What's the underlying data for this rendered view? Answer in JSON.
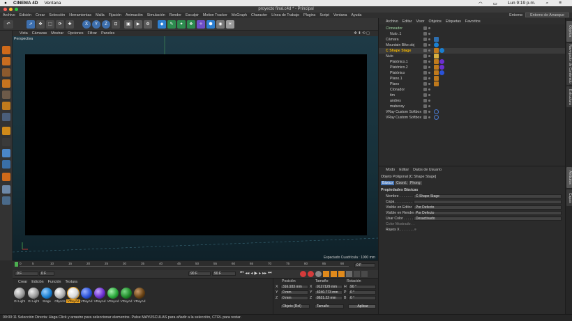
{
  "macbar": {
    "apple": "",
    "app": "CINEMA 4D",
    "menu": "Ventana",
    "clock": "Lun 9:19 p.m."
  },
  "window": {
    "title": "proyecto final.c4d * - Principal"
  },
  "menubar": [
    "Archivo",
    "Edición",
    "Crear",
    "Selección",
    "Herramientas",
    "Malla",
    "Fijación",
    "Animación",
    "Simulación",
    "Render",
    "Esculpir",
    "Motion Tracker",
    "MoGraph",
    "Character",
    "Línea de Trabajo",
    "Plugins",
    "Script",
    "Ventana",
    "Ayuda"
  ],
  "layout": {
    "label": "Entorno:",
    "value": "Entorno de Arranque"
  },
  "toolbar": {
    "x": "X",
    "y": "Y",
    "z": "Z"
  },
  "viewport": {
    "menu": [
      "Vista",
      "Cámaras",
      "Mostrar",
      "Opciones",
      "Filtrar",
      "Paneles"
    ],
    "label": "Perspectiva",
    "grid": "Espaciado Cuadrícula : 1000 mm"
  },
  "timeline": {
    "ticks": [
      "0",
      "5",
      "10",
      "15",
      "20",
      "25",
      "30",
      "35",
      "40",
      "45",
      "50",
      "55",
      "60",
      "65",
      "70",
      "75",
      "80",
      "85",
      "90"
    ],
    "end": "0 F",
    "start_field": "0 F",
    "min_field": "0 F",
    "max_field": "90 F",
    "max_field2": "90 F"
  },
  "materials": {
    "menu": [
      "Crear",
      "Edición",
      "Función",
      "Textura"
    ],
    "items": [
      "GI Light",
      "GI Light",
      "Stage",
      "Objects",
      "VRayAd",
      "VRayAd",
      "VRayAd",
      "VRayAd",
      "VRayAd",
      "VRayAd"
    ],
    "colors": [
      "#9a9a9a",
      "#9a9a9a",
      "#1a7fd1",
      "#b0b0b0",
      "#d8d8d8",
      "#2a52d9",
      "#6b2fd0",
      "#2aa93b",
      "#1f8a2a",
      "#6a4416"
    ]
  },
  "coords": {
    "h_pos": "Posición",
    "h_size": "Tamaño",
    "h_rot": "Rotación",
    "rows": [
      {
        "axis": "X",
        "pos": "316.933 mm",
        "size": "9127129 mm",
        "rlabel": "H",
        "rot": "90 °"
      },
      {
        "axis": "Y",
        "pos": "0 mm",
        "size": "4240.773 mm",
        "rlabel": "P",
        "rot": "0 °"
      },
      {
        "axis": "Z",
        "pos": "0 mm",
        "size": "8621.22 mm",
        "rlabel": "B",
        "rot": "0 °"
      }
    ],
    "mode1": "Objeto (Rel)",
    "mode2": "Tamaño",
    "apply": "Aplicar"
  },
  "objects": {
    "menu": [
      "Archivo",
      "Editar",
      "Visor",
      "Objetos",
      "Etiquetas",
      "Favoritos"
    ],
    "rows": [
      {
        "name": "Cloneador",
        "indent": 0,
        "color": "#9fd3a0"
      },
      {
        "name": "Nulo .1",
        "indent": 1,
        "color": "#ccc"
      },
      {
        "name": "Cámara",
        "indent": 0,
        "color": "#ccc"
      },
      {
        "name": "Mountain Bike.obj",
        "indent": 0,
        "color": "#ccc"
      },
      {
        "name": "C Shape Stage",
        "indent": 0,
        "color": "#f0b400"
      },
      {
        "name": "Nulo",
        "indent": 0,
        "color": "#ccc"
      },
      {
        "name": "Platónico.1",
        "indent": 1,
        "color": "#ccc"
      },
      {
        "name": "Platónico.2",
        "indent": 1,
        "color": "#ccc"
      },
      {
        "name": "Platónico",
        "indent": 1,
        "color": "#ccc"
      },
      {
        "name": "Plano.1",
        "indent": 1,
        "color": "#ccc"
      },
      {
        "name": "Plano",
        "indent": 1,
        "color": "#ccc"
      },
      {
        "name": "Clonador",
        "indent": 1,
        "color": "#ccc"
      },
      {
        "name": "tim",
        "indent": 1,
        "color": "#ccc"
      },
      {
        "name": "andres",
        "indent": 1,
        "color": "#ccc"
      },
      {
        "name": "mabessy",
        "indent": 1,
        "color": "#ccc"
      },
      {
        "name": "VRay Custom Softbox",
        "indent": 0,
        "color": "#ccc"
      },
      {
        "name": "VRay Custom Softbox",
        "indent": 0,
        "color": "#ccc"
      }
    ]
  },
  "attributes": {
    "menu": [
      "Modo",
      "Editar",
      "Datos de Usuario"
    ],
    "object_title": "Objeto Poligonal [C Shape Stage]",
    "tabs": [
      "Básico",
      "Coord.",
      "Phong"
    ],
    "section": "Propiedades Básicas",
    "fields": [
      {
        "label": "Nombre . . . . . . . . .",
        "value": "C Shape Stage"
      },
      {
        "label": "Capa . . . . . . . . . . .",
        "value": ""
      },
      {
        "label": "Visible en Editor",
        "value": "Por Defecto"
      },
      {
        "label": "Visible en Render",
        "value": "Por Defecto"
      },
      {
        "label": "Usar Color . . . . . .",
        "value": "Desactivado"
      },
      {
        "label": "Color Mostrado . .",
        "value": ""
      },
      {
        "label": "Rayos X . . . . . . .",
        "value": ""
      }
    ]
  },
  "sidetabs": [
    "Objetos",
    "Navegador de Contenido",
    "Estructura",
    "Atributos",
    "Capas"
  ],
  "status": {
    "text": "00:00:11    Selección Directa: Haga Click y arrastre para seleccionar elementos. Pulse MAYÚSCULAS para añadir a la selección, CTRL para restar."
  }
}
